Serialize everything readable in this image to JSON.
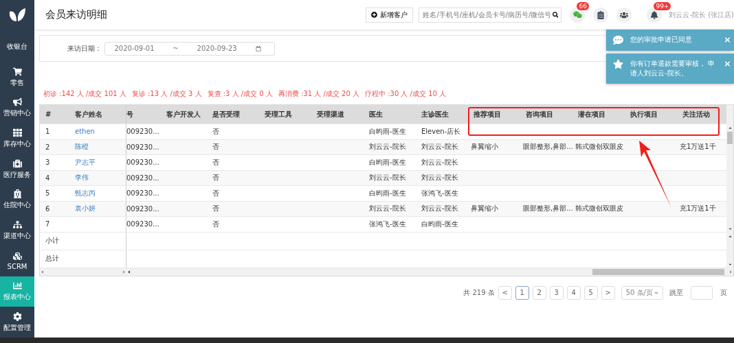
{
  "sidebar": {
    "items": [
      {
        "label": "收银台",
        "selected": false
      },
      {
        "label": "零售",
        "selected": false
      },
      {
        "label": "营销中心",
        "selected": false
      },
      {
        "label": "库存中心",
        "selected": false
      },
      {
        "label": "医疗服务",
        "selected": false
      },
      {
        "label": "住院中心",
        "selected": false
      },
      {
        "label": "渠道中心",
        "selected": false
      },
      {
        "label": "SCRM",
        "selected": false
      },
      {
        "label": "报表中心",
        "selected": true
      },
      {
        "label": "配置管理",
        "selected": false
      }
    ]
  },
  "header": {
    "title": "会员来访明细",
    "add_button": "新增客户",
    "search": {
      "placeholder": "姓名/手机号/座机/会员卡号/病历号/微信号"
    },
    "chat_badge": "66",
    "bell_badge": "99+",
    "user": "刘云云-院长 (张江店)"
  },
  "filter": {
    "label": "来访日期：",
    "date_from": "2020-09-01",
    "separator": "~",
    "date_to": "2020-09-23"
  },
  "stats": [
    "初诊 :142 人 /成交 101 人",
    "复诊 :13 人 /成交 3 人",
    "复查 :3 人 /成交 0 人",
    "再消费 :31 人 /成交 20 人",
    "疗程中 :30 人 /成交 10 人"
  ],
  "notifications": [
    {
      "text": "您的审批申请已同意",
      "close": "×"
    },
    {
      "text": "你有订单退款需要审核， 申请人刘云云-院长。",
      "close": "×"
    }
  ],
  "table": {
    "columns": [
      "#",
      "客户姓名",
      "号",
      "客户开发人",
      "是否受理",
      "受理工具",
      "受理渠道",
      "医生",
      "主诊医生",
      "推荐项目",
      "咨询项目",
      "潜在项目",
      "执行项目",
      "关注活动"
    ],
    "rows": [
      {
        "cells": [
          "1",
          "ethen",
          "009230...",
          "",
          "否",
          "",
          "",
          "白昀雨-医生",
          "Eleven-店长",
          "",
          "",
          "",
          "",
          ""
        ]
      },
      {
        "cells": [
          "2",
          "陈橙",
          "009230...",
          "",
          "否",
          "",
          "",
          "刘云云-院长",
          "刘云云-院长",
          "鼻翼缩小",
          "眼部整形,鼻部...",
          "韩式微创双眼皮",
          "",
          "充1万送1千"
        ]
      },
      {
        "cells": [
          "3",
          "尹志平",
          "009230...",
          "",
          "否",
          "",
          "",
          "白昀雨-医生",
          "刘云云-院长",
          "",
          "",
          "",
          "",
          ""
        ]
      },
      {
        "cells": [
          "4",
          "李伟",
          "009230...",
          "",
          "否",
          "",
          "",
          "刘云云-院长",
          "刘云云-院长",
          "",
          "",
          "",
          "",
          ""
        ]
      },
      {
        "cells": [
          "5",
          "甄志丙",
          "009230...",
          "",
          "否",
          "",
          "",
          "白昀雨-医生",
          "张鸿飞-医生",
          "",
          "",
          "",
          "",
          ""
        ]
      },
      {
        "cells": [
          "6",
          "袁小妍",
          "009230...",
          "",
          "否",
          "",
          "",
          "刘云云-院长",
          "刘云云-院长",
          "鼻翼缩小",
          "眼部整形,鼻部...",
          "韩式微创双眼皮",
          "",
          "充1万送1千"
        ]
      },
      {
        "cells": [
          "7",
          "",
          "009230...",
          "",
          "否",
          "",
          "",
          "张鸿飞-医生",
          "白昀雨-医生",
          "",
          "",
          "",
          "",
          ""
        ]
      }
    ],
    "summary": [
      "小计",
      "总计"
    ]
  },
  "pagination": {
    "total": "共 219 条",
    "prev": "<",
    "pages": [
      {
        "label": "1",
        "selected": true
      },
      {
        "label": "2",
        "selected": false
      },
      {
        "label": "3",
        "selected": false
      },
      {
        "label": "4",
        "selected": false
      },
      {
        "label": "5",
        "selected": false
      }
    ],
    "next": ">",
    "page_size": "50 条/页",
    "jump_label": "跳至",
    "jump_suffix": "页"
  }
}
